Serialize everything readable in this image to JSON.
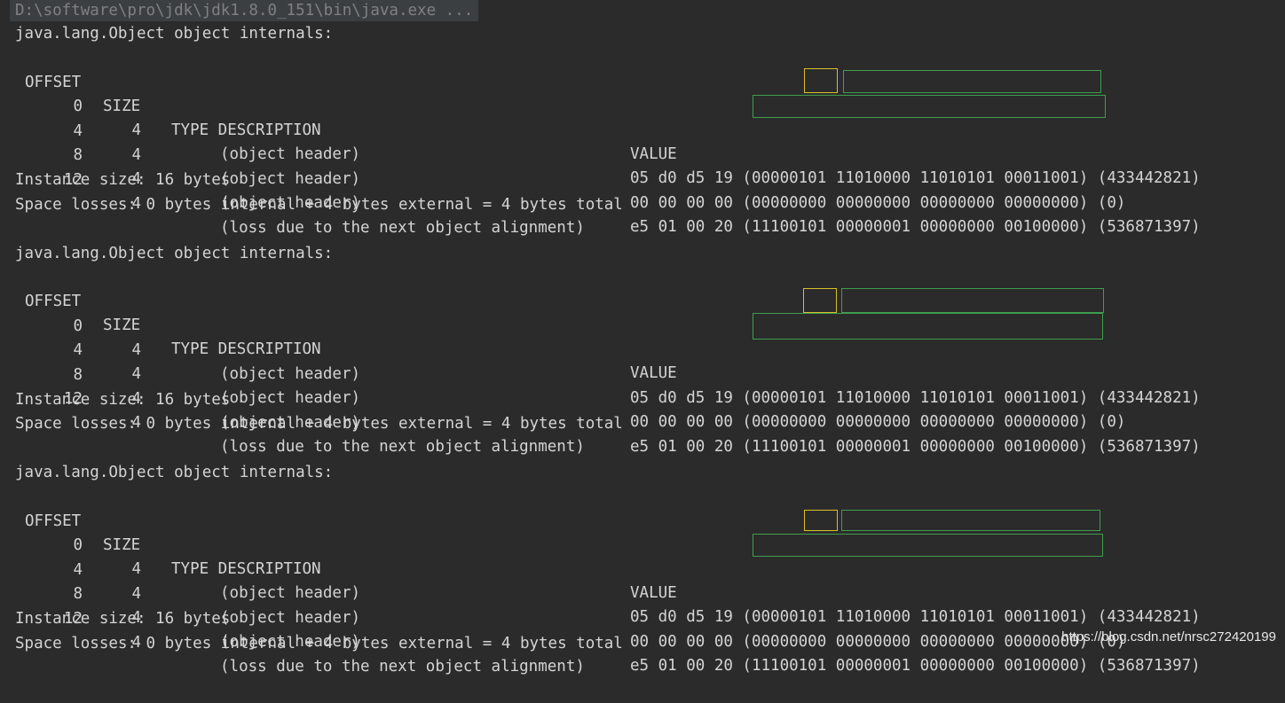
{
  "console": {
    "command": "D:\\software\\pro\\jdk\\jdk1.8.0_151\\bin\\java.exe ...",
    "blocks": [
      {
        "title": "java.lang.Object object internals:",
        "headers": {
          "offset": "OFFSET",
          "size": "SIZE",
          "type_desc": "TYPE DESCRIPTION",
          "value": "VALUE"
        },
        "rows": [
          {
            "offset": "0",
            "size": "4",
            "description": "(object header)",
            "value": "05 d0 d5 19 (00000101 11010000 11010101 00011001) (433442821)"
          },
          {
            "offset": "4",
            "size": "4",
            "description": "(object header)",
            "value": "00 00 00 00 (00000000 00000000 00000000 00000000) (0)"
          },
          {
            "offset": "8",
            "size": "4",
            "description": "(object header)",
            "value": "e5 01 00 20 (11100101 00000001 00000000 00100000) (536871397)"
          },
          {
            "offset": "12",
            "size": "4",
            "description": "(loss due to the next object alignment)",
            "value": ""
          }
        ],
        "instance_size": "Instance size: 16 bytes",
        "space_losses": "Space losses: 0 bytes internal + 4 bytes external = 4 bytes total"
      },
      {
        "title": "java.lang.Object object internals:",
        "headers": {
          "offset": "OFFSET",
          "size": "SIZE",
          "type_desc": "TYPE DESCRIPTION",
          "value": "VALUE"
        },
        "rows": [
          {
            "offset": "0",
            "size": "4",
            "description": "(object header)",
            "value": "05 d0 d5 19 (00000101 11010000 11010101 00011001) (433442821)"
          },
          {
            "offset": "4",
            "size": "4",
            "description": "(object header)",
            "value": "00 00 00 00 (00000000 00000000 00000000 00000000) (0)"
          },
          {
            "offset": "8",
            "size": "4",
            "description": "(object header)",
            "value": "e5 01 00 20 (11100101 00000001 00000000 00100000) (536871397)"
          },
          {
            "offset": "12",
            "size": "4",
            "description": "(loss due to the next object alignment)",
            "value": ""
          }
        ],
        "instance_size": "Instance size: 16 bytes",
        "space_losses": "Space losses: 0 bytes internal + 4 bytes external = 4 bytes total"
      },
      {
        "title": "java.lang.Object object internals:",
        "headers": {
          "offset": "OFFSET",
          "size": "SIZE",
          "type_desc": "TYPE DESCRIPTION",
          "value": "VALUE"
        },
        "rows": [
          {
            "offset": "0",
            "size": "4",
            "description": "(object header)",
            "value": "05 d0 d5 19 (00000101 11010000 11010101 00011001) (433442821)"
          },
          {
            "offset": "4",
            "size": "4",
            "description": "(object header)",
            "value": "00 00 00 00 (00000000 00000000 00000000 00000000) (0)"
          },
          {
            "offset": "8",
            "size": "4",
            "description": "(object header)",
            "value": "e5 01 00 20 (11100101 00000001 00000000 00100000) (536871397)"
          },
          {
            "offset": "12",
            "size": "4",
            "description": "(loss due to the next object alignment)",
            "value": ""
          }
        ],
        "instance_size": "Instance size: 16 bytes",
        "space_losses": "Space losses: 0 bytes internal + 4 bytes external = 4 bytes total"
      }
    ]
  },
  "watermark": "https://blog.csdn.net/nrsc272420199",
  "colors": {
    "background": "#2b2b2b",
    "text": "#d4d4d4",
    "highlight_yellow": "#d7c02c",
    "highlight_green": "#3f9d4e"
  }
}
